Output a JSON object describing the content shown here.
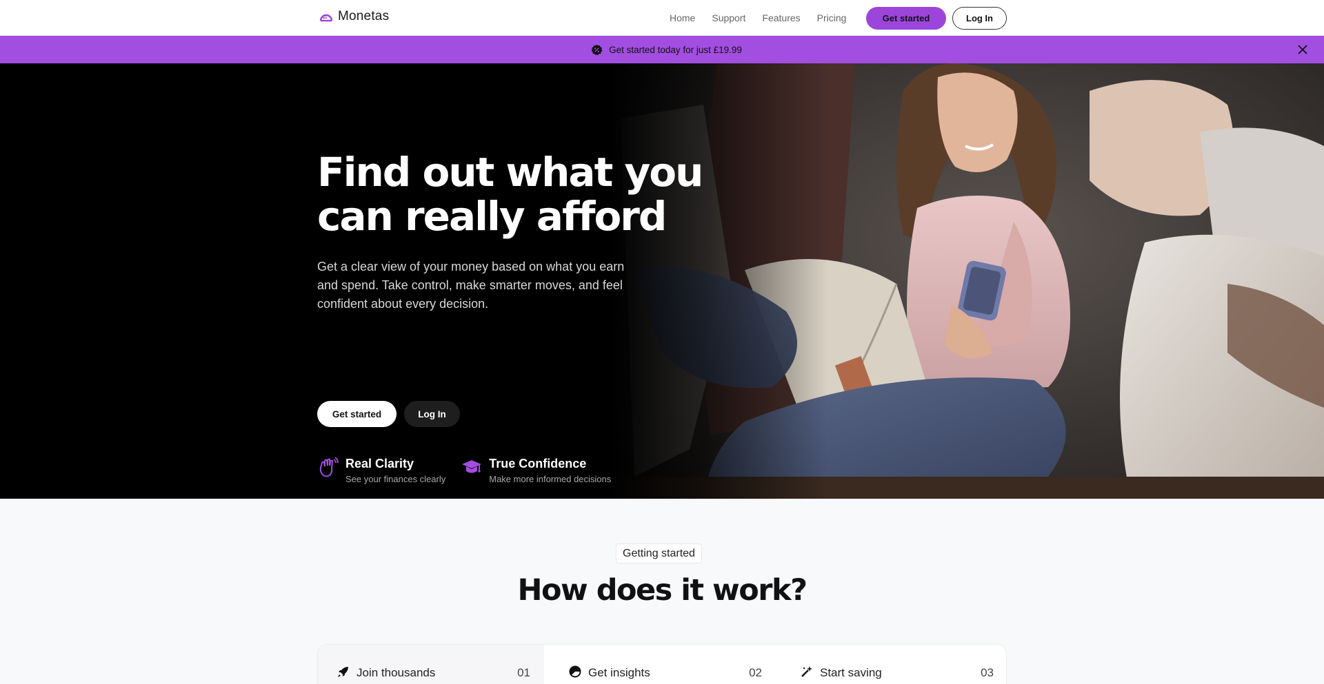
{
  "brand": {
    "name": "Monetas",
    "accent": "#9c45db"
  },
  "nav": {
    "links": [
      "Home",
      "Support",
      "Features",
      "Pricing"
    ],
    "cta_primary": "Get started",
    "cta_secondary": "Log In"
  },
  "banner": {
    "text": "Get started today for just £19.99",
    "icon": "badge-percent-icon",
    "close_icon": "close-icon",
    "color": "#a24ee0"
  },
  "hero": {
    "title_line1": "Find out what you",
    "title_line2": "can really afford",
    "subtitle": "Get a clear view of your money based on what you earn and spend. Take control, make smarter moves, and feel confident about every decision.",
    "cta_primary": "Get started",
    "cta_secondary": "Log In",
    "features": [
      {
        "icon": "waving-hand-icon",
        "title": "Real Clarity",
        "description": "See your finances clearly"
      },
      {
        "icon": "graduation-cap-icon",
        "title": "True Confidence",
        "description": "Make more informed decisions"
      }
    ]
  },
  "how_it_works": {
    "tag": "Getting started",
    "title": "How does it work?",
    "steps": [
      {
        "icon": "rocket-icon",
        "label": "Join thousands",
        "number": "01"
      },
      {
        "icon": "pie-chart-icon",
        "label": "Get insights",
        "number": "02"
      },
      {
        "icon": "magic-wand-icon",
        "label": "Start saving",
        "number": "03"
      }
    ]
  }
}
